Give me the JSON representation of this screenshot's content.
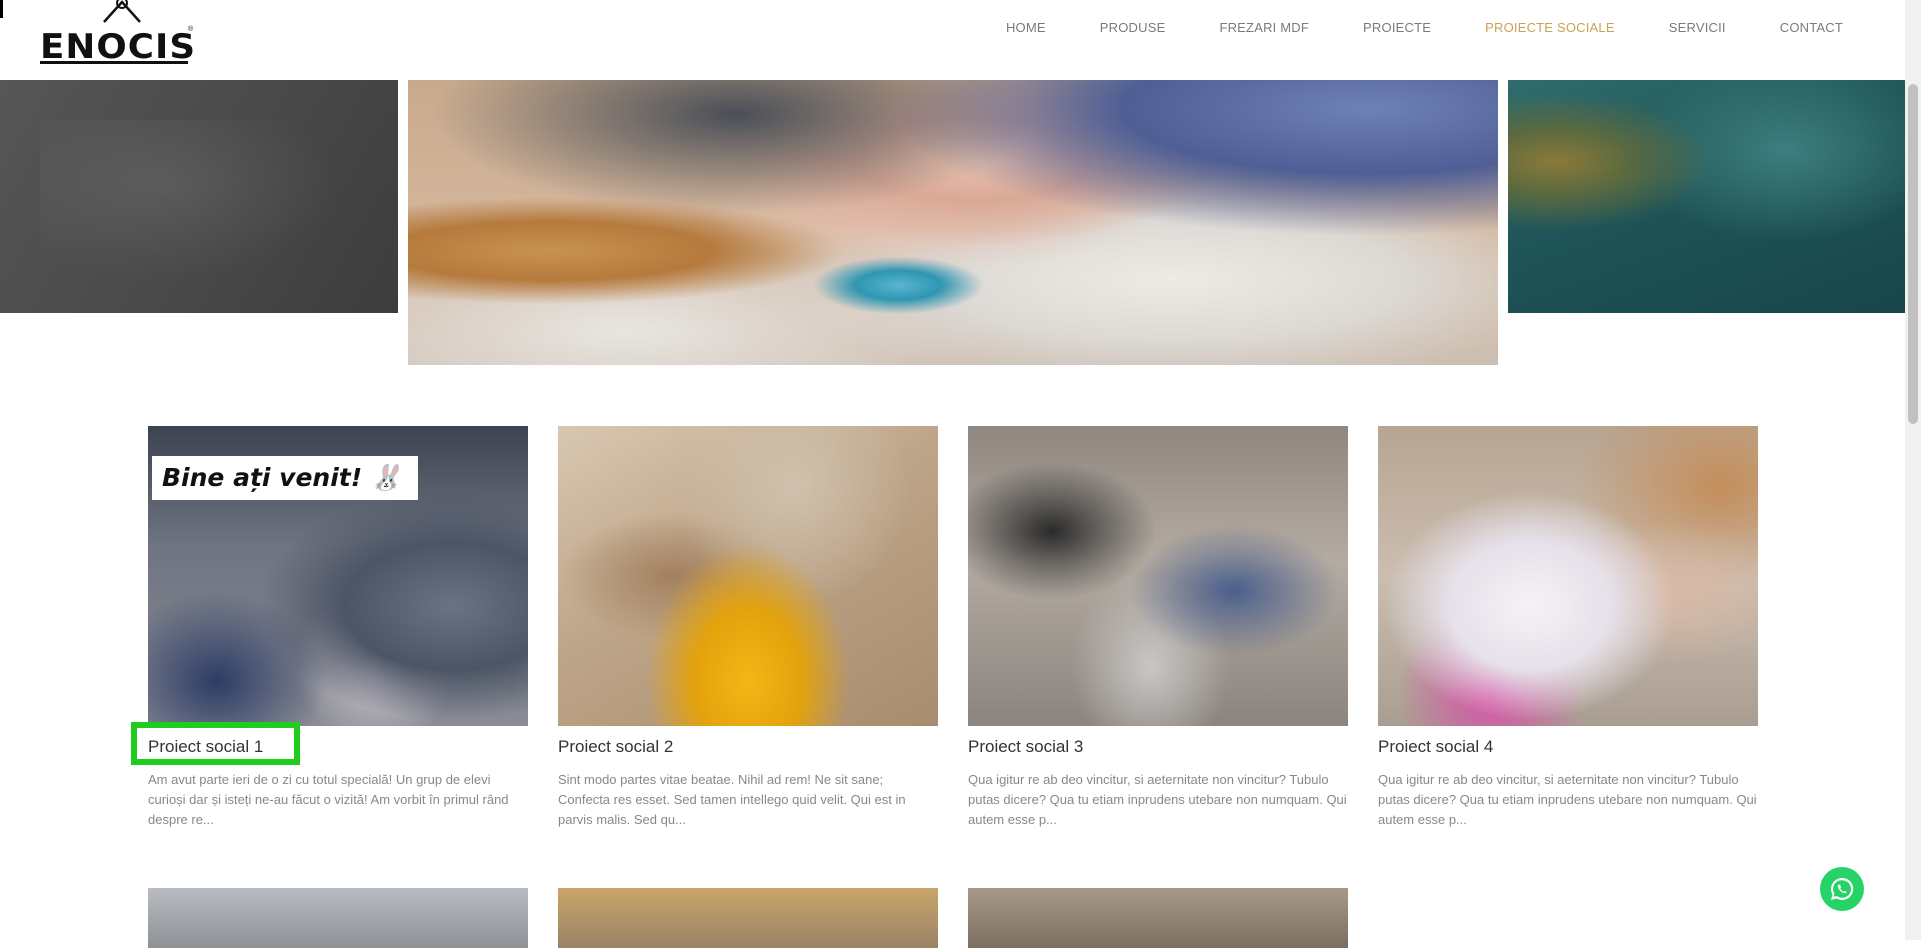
{
  "brand": {
    "logo_text": "ENOCIS",
    "registered_mark": "®"
  },
  "nav": {
    "items": [
      {
        "label": "HOME"
      },
      {
        "label": "PRODUSE"
      },
      {
        "label": "FREZARI MDF"
      },
      {
        "label": "PROIECTE"
      },
      {
        "label": "PROIECTE SOCIALE",
        "active": true
      },
      {
        "label": "SERVICII"
      },
      {
        "label": "CONTACT"
      }
    ],
    "active_color": "#c9a255"
  },
  "cards": [
    {
      "title": "Proiect social 1",
      "image_banner": "Bine ați venit! 🐰",
      "excerpt": "Am avut parte ieri de o zi cu totul specială! Un grup de elevi curioși dar și isteți ne-au făcut o vizită! Am vorbit în primul rând despre re..."
    },
    {
      "title": "Proiect social 2",
      "excerpt": "Sint modo partes vitae beatae. Nihil ad rem! Ne sit sane; Confecta res esset. Sed tamen intellego quid velit. Qui est in parvis malis. Sed qu..."
    },
    {
      "title": "Proiect social 3",
      "excerpt": "Qua igitur re ab deo vincitur, si aeternitate non vincitur? Tubulo putas dicere? Qua tu etiam inprudens utebare non numquam. Qui autem esse p..."
    },
    {
      "title": "Proiect social 4",
      "excerpt": "Qua igitur re ab deo vincitur, si aeternitate non vincitur? Tubulo putas dicere? Qua tu etiam inprudens utebare non numquam. Qui autem esse p..."
    }
  ],
  "highlight_color": "#1fcc1f",
  "whatsapp": {
    "icon": "whatsapp-icon",
    "color": "#25d366"
  }
}
